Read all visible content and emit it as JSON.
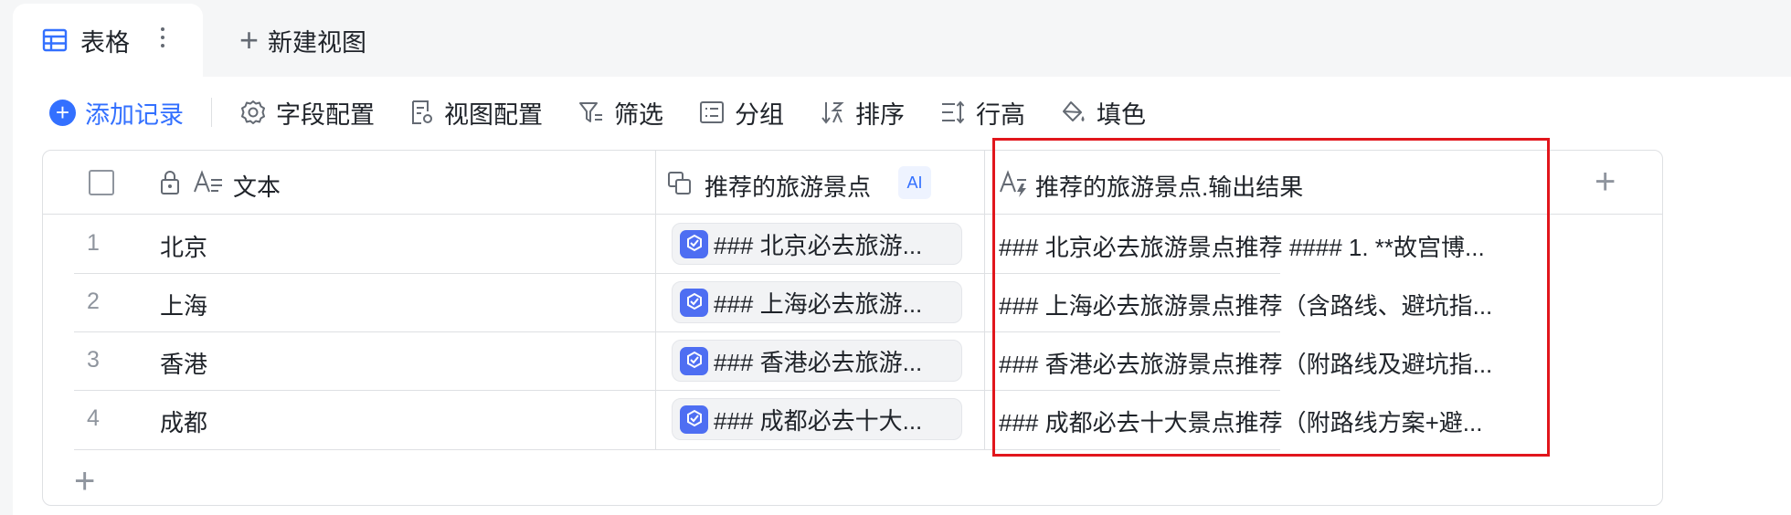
{
  "tabs": {
    "active_label": "表格",
    "new_view_label": "新建视图"
  },
  "toolbar": {
    "add_record": "添加记录",
    "field_config": "字段配置",
    "view_config": "视图配置",
    "filter": "筛选",
    "group": "分组",
    "sort": "排序",
    "row_height": "行高",
    "fill_color": "填色"
  },
  "table": {
    "columns": {
      "text": "文本",
      "recommended": "推荐的旅游景点",
      "ai_badge": "AI",
      "output": "推荐的旅游景点.输出结果"
    },
    "rows": [
      {
        "num": "1",
        "city": "北京",
        "chip": "### 北京必去旅游...",
        "output": "### 北京必去旅游景点推荐 #### 1. **故宫博..."
      },
      {
        "num": "2",
        "city": "上海",
        "chip": "### 上海必去旅游...",
        "output": "### 上海必去旅游景点推荐（含路线、避坑指..."
      },
      {
        "num": "3",
        "city": "香港",
        "chip": "### 香港必去旅游...",
        "output": "### 香港必去旅游景点推荐（附路线及避坑指..."
      },
      {
        "num": "4",
        "city": "成都",
        "chip": "### 成都必去十大...",
        "output": "### 成都必去十大景点推荐（附路线方案+避..."
      }
    ]
  },
  "colors": {
    "accent": "#3370ff",
    "highlight": "#e1161c",
    "chip_icon": "#4e6ef2"
  }
}
